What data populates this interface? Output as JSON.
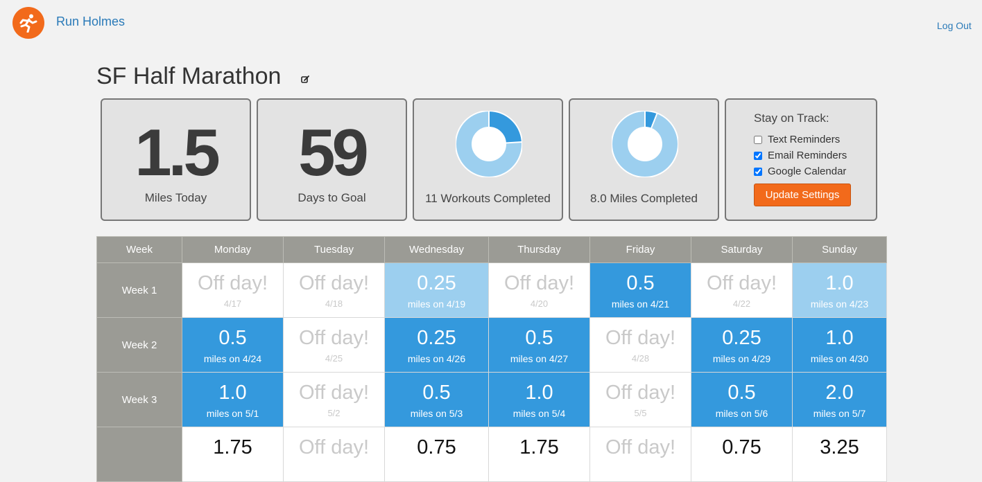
{
  "header": {
    "brand": "Run Holmes",
    "logout": "Log Out",
    "logo_icon": "runner-icon",
    "brand_color": "#f26a1b"
  },
  "goal": {
    "title": "SF Half Marathon",
    "edit_icon": "edit-icon"
  },
  "stats": {
    "miles_today": {
      "value": "1.5",
      "label": "Miles Today"
    },
    "days_to_goal": {
      "value": "59",
      "label": "Days to Goal"
    },
    "workouts": {
      "label": "11 Workouts Completed",
      "completed_fraction": 0.24
    },
    "miles": {
      "label": "8.0 Miles Completed",
      "completed_fraction": 0.06
    }
  },
  "reminders": {
    "title": "Stay on Track:",
    "options": [
      {
        "label": "Text Reminders",
        "checked": false
      },
      {
        "label": "Email Reminders",
        "checked": true
      },
      {
        "label": "Google Calendar",
        "checked": true
      }
    ],
    "button": "Update Settings"
  },
  "schedule": {
    "headers": [
      "Week",
      "Monday",
      "Tuesday",
      "Wednesday",
      "Thursday",
      "Friday",
      "Saturday",
      "Sunday"
    ],
    "weeks": [
      {
        "label": "Week 1",
        "days": [
          {
            "main": "Off day!",
            "sub": "4/17",
            "status": "off"
          },
          {
            "main": "Off day!",
            "sub": "4/18",
            "status": "off"
          },
          {
            "main": "0.25",
            "sub": "miles on 4/19",
            "status": "run-light"
          },
          {
            "main": "Off day!",
            "sub": "4/20",
            "status": "off"
          },
          {
            "main": "0.5",
            "sub": "miles on 4/21",
            "status": "run"
          },
          {
            "main": "Off day!",
            "sub": "4/22",
            "status": "off"
          },
          {
            "main": "1.0",
            "sub": "miles on 4/23",
            "status": "run-light"
          }
        ]
      },
      {
        "label": "Week 2",
        "days": [
          {
            "main": "0.5",
            "sub": "miles on 4/24",
            "status": "run"
          },
          {
            "main": "Off day!",
            "sub": "4/25",
            "status": "off"
          },
          {
            "main": "0.25",
            "sub": "miles on 4/26",
            "status": "run"
          },
          {
            "main": "0.5",
            "sub": "miles on 4/27",
            "status": "run"
          },
          {
            "main": "Off day!",
            "sub": "4/28",
            "status": "off"
          },
          {
            "main": "0.25",
            "sub": "miles on 4/29",
            "status": "run"
          },
          {
            "main": "1.0",
            "sub": "miles on 4/30",
            "status": "run"
          }
        ]
      },
      {
        "label": "Week 3",
        "days": [
          {
            "main": "1.0",
            "sub": "miles on 5/1",
            "status": "run"
          },
          {
            "main": "Off day!",
            "sub": "5/2",
            "status": "off"
          },
          {
            "main": "0.5",
            "sub": "miles on 5/3",
            "status": "run"
          },
          {
            "main": "1.0",
            "sub": "miles on 5/4",
            "status": "run"
          },
          {
            "main": "Off day!",
            "sub": "5/5",
            "status": "off"
          },
          {
            "main": "0.5",
            "sub": "miles on 5/6",
            "status": "run"
          },
          {
            "main": "2.0",
            "sub": "miles on 5/7",
            "status": "run"
          }
        ]
      },
      {
        "label": "",
        "days": [
          {
            "main": "1.75",
            "sub": "",
            "status": "pending"
          },
          {
            "main": "Off day!",
            "sub": "",
            "status": "off"
          },
          {
            "main": "0.75",
            "sub": "",
            "status": "pending"
          },
          {
            "main": "1.75",
            "sub": "",
            "status": "pending"
          },
          {
            "main": "Off day!",
            "sub": "",
            "status": "off"
          },
          {
            "main": "0.75",
            "sub": "",
            "status": "pending"
          },
          {
            "main": "3.25",
            "sub": "",
            "status": "pending"
          }
        ]
      }
    ]
  },
  "colors": {
    "run": "#3499dd",
    "run_light": "#9ccfef",
    "table_header": "#9b9b95",
    "donut_done": "#3499dd",
    "donut_remaining": "#9ccfef"
  }
}
